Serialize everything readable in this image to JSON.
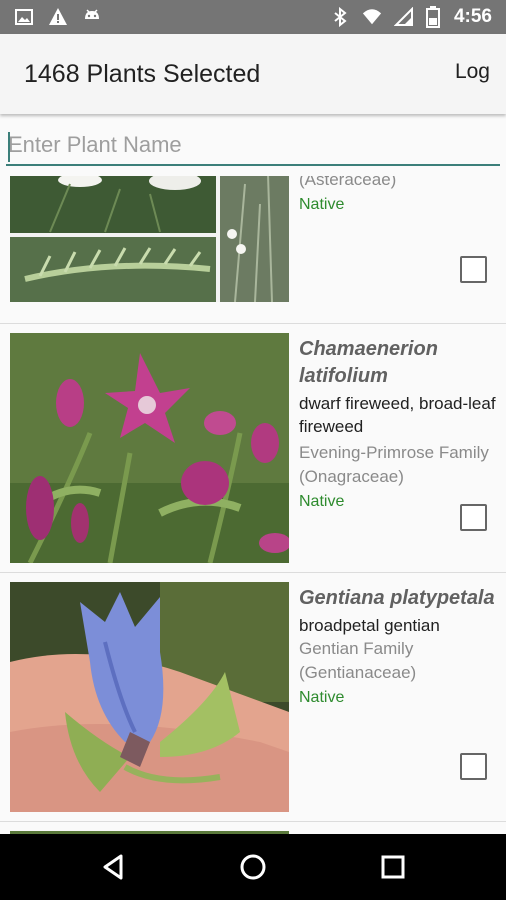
{
  "status_bar": {
    "time": "4:56",
    "left_icons": [
      "image-icon",
      "warning-icon",
      "android-icon"
    ],
    "right_icons": [
      "bluetooth-icon",
      "wifi-icon",
      "signal-icon",
      "battery-icon"
    ]
  },
  "app_bar": {
    "title": "1468 Plants Selected",
    "log_label": "Log"
  },
  "search": {
    "placeholder": "Enter Plant Name"
  },
  "plants": [
    {
      "scientific_name": "",
      "common_name": "",
      "family": "(Asteraceae)",
      "status": "Native",
      "selected": false,
      "image": "yarrow-photo"
    },
    {
      "scientific_name": "Chamaenerion latifolium",
      "common_name": "dwarf fireweed, broad-leaf fireweed",
      "family": "Evening-Primrose Family (Onagraceae)",
      "status": "Native",
      "selected": false,
      "image": "fireweed-photo"
    },
    {
      "scientific_name": "Gentiana platypetala",
      "common_name": "broadpetal gentian",
      "family": "Gentian Family (Gentianaceae)",
      "status": "Native",
      "selected": false,
      "image": "gentian-photo"
    }
  ],
  "colors": {
    "status_bar": "#757575",
    "accent": "#3c7f7a",
    "native_green": "#2e8b2e"
  },
  "nav_bar": {
    "buttons": [
      "back-icon",
      "home-icon",
      "recents-icon"
    ]
  }
}
